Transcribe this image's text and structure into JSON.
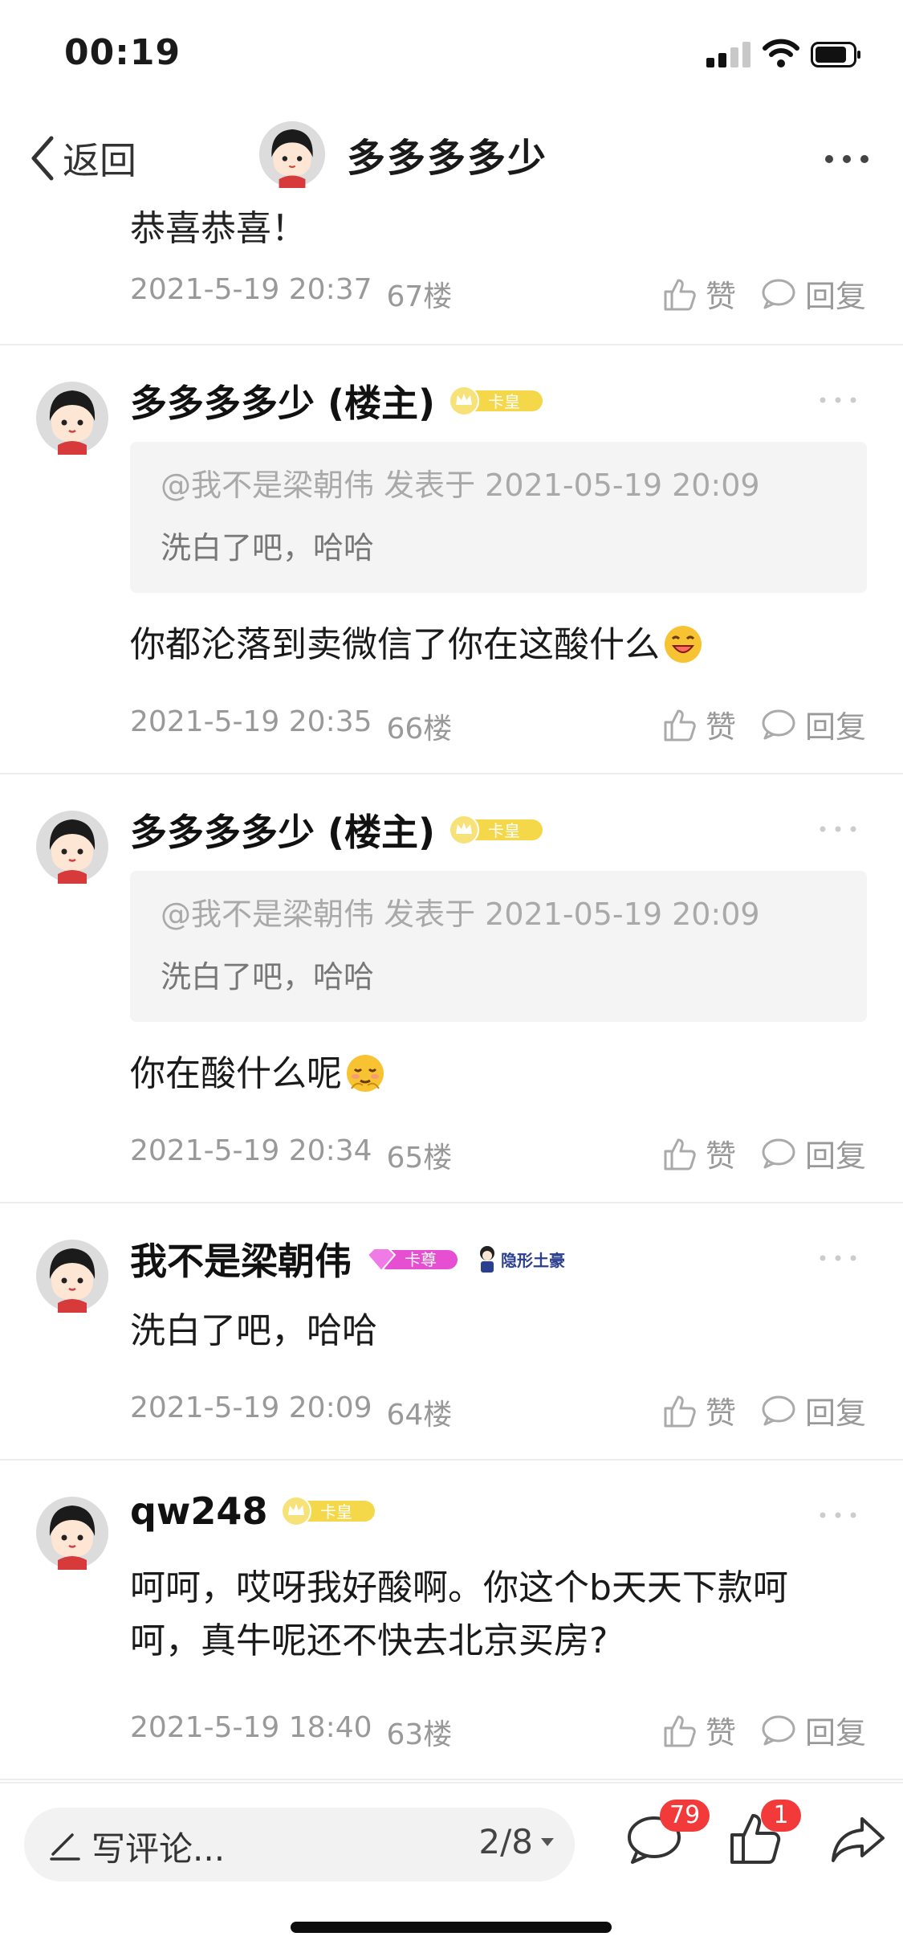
{
  "status_bar": {
    "time": "00:19"
  },
  "nav": {
    "back_label": "返回",
    "title": "多多多多少"
  },
  "partial_comment": {
    "text": "恭喜恭喜！",
    "date": "2021-5-19 20:37",
    "floor": "67楼",
    "like_label": "赞",
    "reply_label": "回复"
  },
  "comments": [
    {
      "author": "多多多多少 (楼主)",
      "badge": "卡皇",
      "quote_meta": "@我不是梁朝伟 发表于 2021-05-19 20:09",
      "quote_text": "洗白了吧，哈哈",
      "text": "你都沦落到卖微信了你在这酸什么",
      "date": "2021-5-19 20:35",
      "floor": "66楼",
      "like_label": "赞",
      "reply_label": "回复"
    },
    {
      "author": "多多多多少 (楼主)",
      "badge": "卡皇",
      "quote_meta": "@我不是梁朝伟 发表于 2021-05-19 20:09",
      "quote_text": "洗白了吧，哈哈",
      "text": "你在酸什么呢",
      "date": "2021-5-19 20:34",
      "floor": "65楼",
      "like_label": "赞",
      "reply_label": "回复"
    },
    {
      "author": "我不是梁朝伟",
      "badge": "卡尊",
      "badge2": "隐形土豪",
      "text": "洗白了吧，哈哈",
      "date": "2021-5-19 20:09",
      "floor": "64楼",
      "like_label": "赞",
      "reply_label": "回复"
    },
    {
      "author": "qw248",
      "badge": "卡皇",
      "text_line1": "呵呵，哎呀我好酸啊。你这个b天天下款呵",
      "text_line2": "呵，真牛呢还不快去北京买房?",
      "date": "2021-5-19 18:40",
      "floor": "63楼",
      "like_label": "赞",
      "reply_label": "回复"
    }
  ],
  "bottom_bar": {
    "composer_placeholder": "写评论...",
    "pager": "2/8",
    "comment_count": "79",
    "like_count": "1"
  },
  "colors": {
    "badge_red": "#f23a3a",
    "gold": "#f5d84a",
    "pink": "#e64fd2"
  }
}
